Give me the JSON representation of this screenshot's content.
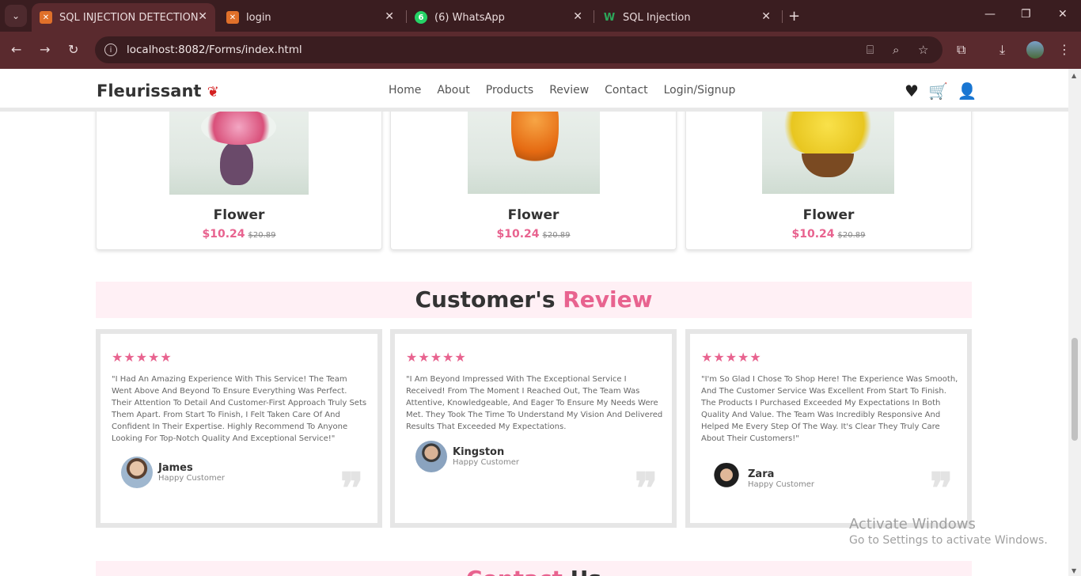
{
  "browser": {
    "tabs": [
      {
        "title": "SQL INJECTION DETECTION",
        "active": true
      },
      {
        "title": "login",
        "active": false
      },
      {
        "title": "(6) WhatsApp",
        "active": false
      },
      {
        "title": "SQL Injection",
        "active": false
      }
    ],
    "url": "localhost:8082/Forms/index.html"
  },
  "site": {
    "logo": "Fleurissant",
    "nav": [
      "Home",
      "About",
      "Products",
      "Review",
      "Contact",
      "Login/Signup"
    ]
  },
  "products": [
    {
      "name": "Flower",
      "price": "$10.24",
      "old_price": "$20.89"
    },
    {
      "name": "Flower",
      "price": "$10.24",
      "old_price": "$20.89"
    },
    {
      "name": "Flower",
      "price": "$10.24",
      "old_price": "$20.89"
    }
  ],
  "review_section": {
    "title_a": "Customer's",
    "title_b": "Review"
  },
  "reviews": [
    {
      "stars": "★★★★★",
      "text": "\"I Had An Amazing Experience With This Service! The Team Went Above And Beyond To Ensure Everything Was Perfect. Their Attention To Detail And Customer-First Approach Truly Sets Them Apart. From Start To Finish, I Felt Taken Care Of And Confident In Their Expertise. Highly Recommend To Anyone Looking For Top-Notch Quality And Exceptional Service!\"",
      "name": "James",
      "role": "Happy Customer"
    },
    {
      "stars": "★★★★★",
      "text": "\"I Am Beyond Impressed With The Exceptional Service I Received! From The Moment I Reached Out, The Team Was Attentive, Knowledgeable, And Eager To Ensure My Needs Were Met. They Took The Time To Understand My Vision And Delivered Results That Exceeded My Expectations.",
      "name": "Kingston",
      "role": "Happy Customer"
    },
    {
      "stars": "★★★★★",
      "text": "\"I'm So Glad I Chose To Shop Here! The Experience Was Smooth, And The Customer Service Was Excellent From Start To Finish. The Products I Purchased Exceeded My Expectations In Both Quality And Value. The Team Was Incredibly Responsive And Helped Me Every Step Of The Way. It's Clear They Truly Care About Their Customers!\"",
      "name": "Zara",
      "role": "Happy Customer"
    }
  ],
  "contact_section": {
    "title_a": "Contact",
    "title_b": "Us"
  },
  "watermark": {
    "line1": "Activate Windows",
    "line2": "Go to Settings to activate Windows."
  },
  "colors": {
    "accent": "#e8638f",
    "browser_frame": "#3a1d20"
  }
}
